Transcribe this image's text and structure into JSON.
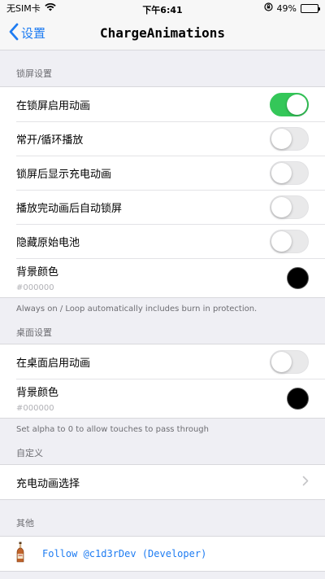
{
  "status": {
    "carrier": "无SIM卡",
    "time": "下午6:41",
    "battery_text": "49%",
    "battery_level": 0.49
  },
  "nav": {
    "back_label": "设置",
    "title": "ChargeAnimations"
  },
  "lock_section": {
    "header": "锁屏设置",
    "rows": [
      {
        "label": "在锁屏启用动画",
        "on": true
      },
      {
        "label": "常开/循环播放",
        "on": false
      },
      {
        "label": "锁屏后显示充电动画",
        "on": false
      },
      {
        "label": "播放完动画后自动锁屏",
        "on": false
      },
      {
        "label": "隐藏原始电池",
        "on": false
      }
    ],
    "bg_color_label": "背景颜色",
    "bg_color_value": "#000000",
    "footer": "Always on / Loop automatically includes burn in protection."
  },
  "desktop_section": {
    "header": "桌面设置",
    "enable_label": "在桌面启用动画",
    "enable_on": false,
    "bg_color_label": "背景颜色",
    "bg_color_value": "#000000",
    "footer": "Set alpha to 0 to allow touches to pass through"
  },
  "custom_section": {
    "header": "自定义",
    "picker_label": "充电动画选择"
  },
  "other_section": {
    "header": "其他",
    "follow_label": "Follow @c1d3rDev (Developer)"
  },
  "colors": {
    "accent": "#1e7cf2",
    "toggle_on": "#34c759",
    "background": "#efeff4"
  }
}
